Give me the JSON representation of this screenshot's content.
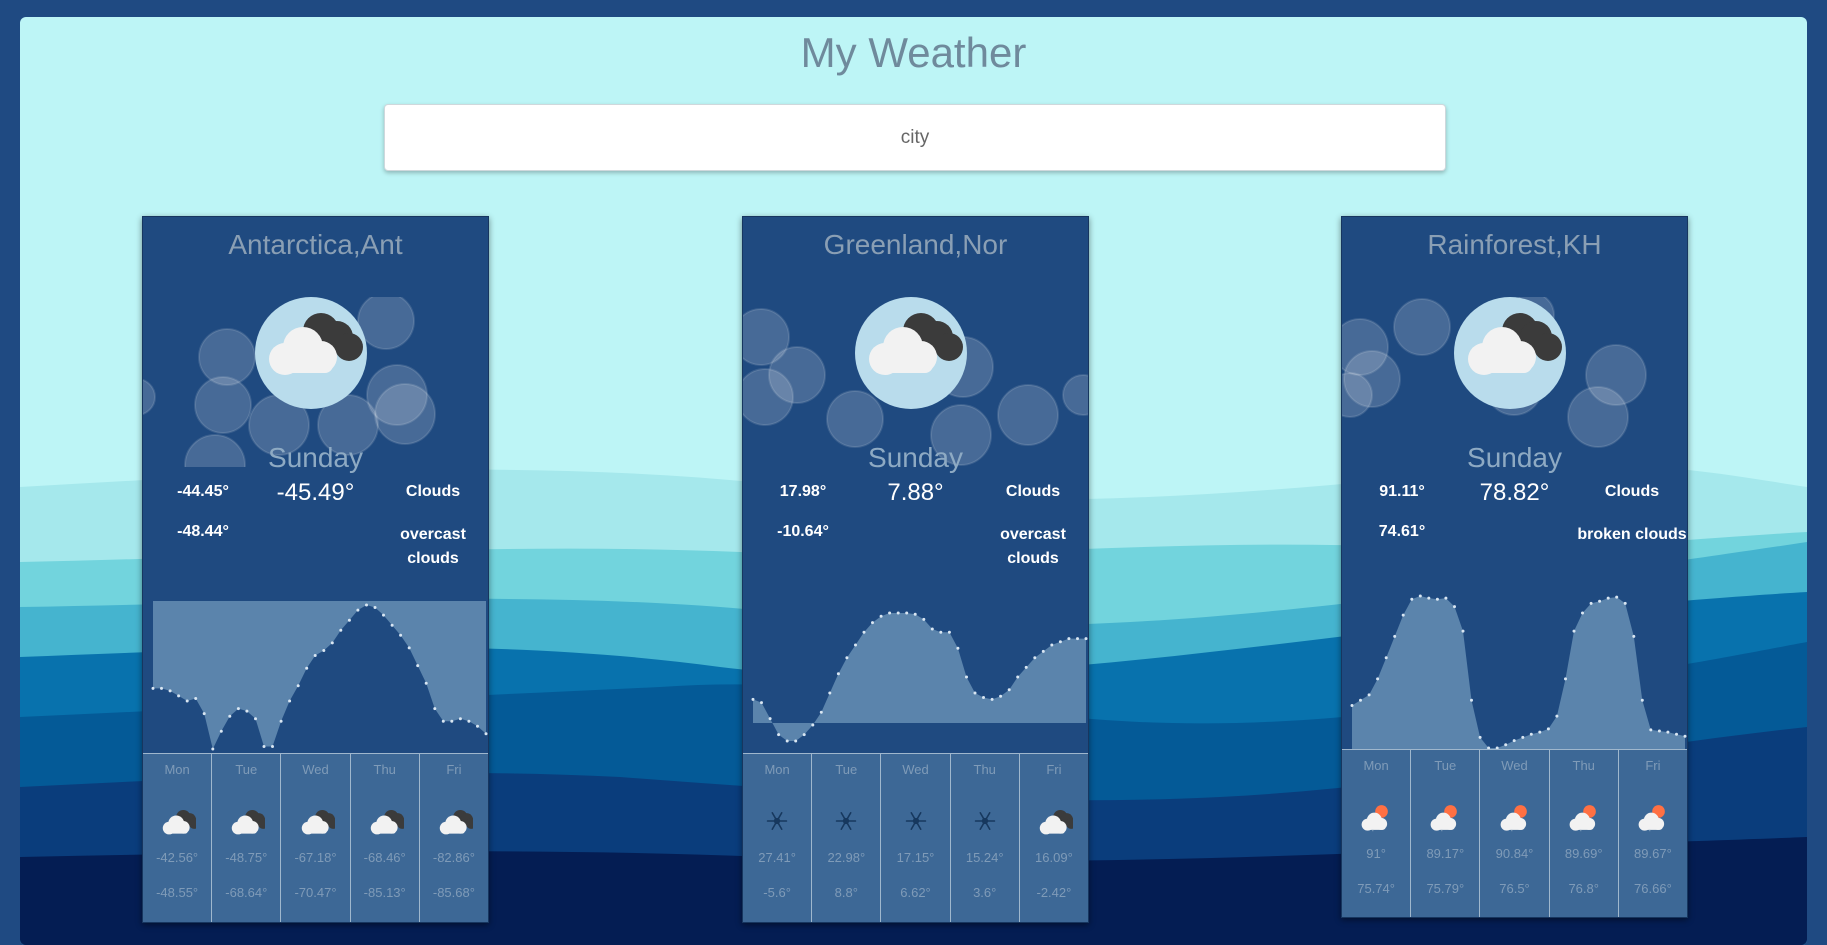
{
  "app": {
    "title": "My Weather"
  },
  "search": {
    "placeholder": "city"
  },
  "cards": [
    {
      "name": "Antarctica,Ant",
      "day": "Sunday",
      "icon": "cloudy-icon",
      "temp_high": "-44.45°",
      "temp_low": "-48.44°",
      "temp_current": "-45.49°",
      "condition": "Clouds",
      "description": "overcast clouds",
      "chart_style": "inverted",
      "trend": [
        -47.5,
        -47.5,
        -47.6,
        -47.8,
        -48.0,
        -47.9,
        -48.5,
        -49.9,
        -49.2,
        -48.6,
        -48.3,
        -48.4,
        -48.7,
        -49.8,
        -49.8,
        -48.8,
        -48.0,
        -47.4,
        -46.7,
        -46.2,
        -46.0,
        -45.7,
        -45.2,
        -44.8,
        -44.4,
        -44.2,
        -44.3,
        -44.6,
        -45.0,
        -45.4,
        -45.9,
        -46.6,
        -47.3,
        -48.3,
        -48.8,
        -48.8,
        -48.7,
        -48.8,
        -49.0,
        -49.3
      ],
      "forecast": [
        {
          "day": "Mon",
          "icon": "cloudy-icon",
          "high": "-42.56°",
          "low": "-48.55°"
        },
        {
          "day": "Tue",
          "icon": "cloudy-icon",
          "high": "-48.75°",
          "low": "-68.64°"
        },
        {
          "day": "Wed",
          "icon": "cloudy-icon",
          "high": "-67.18°",
          "low": "-70.47°"
        },
        {
          "day": "Thu",
          "icon": "cloudy-icon",
          "high": "-68.46°",
          "low": "-85.13°"
        },
        {
          "day": "Fri",
          "icon": "cloudy-icon",
          "high": "-82.86°",
          "low": "-85.68°"
        }
      ]
    },
    {
      "name": "Greenland,Nor",
      "day": "Sunday",
      "icon": "cloudy-icon",
      "temp_high": "17.98°",
      "temp_low": "-10.64°",
      "temp_current": "7.88°",
      "condition": "Clouds",
      "description": "overcast clouds",
      "chart_style": "baseline",
      "trend": [
        4.0,
        3.5,
        1.0,
        -1.5,
        -2.5,
        -2.5,
        -1.5,
        0,
        2,
        5,
        8,
        10.5,
        12.5,
        14.5,
        16,
        17,
        17.5,
        17.5,
        17.5,
        17.3,
        16.5,
        15,
        14.5,
        14.5,
        12,
        7.5,
        5,
        4.3,
        4.0,
        4.5,
        5.5,
        7.5,
        9,
        10.5,
        11.5,
        12.5,
        13.0,
        13.5,
        13.5,
        13.5
      ],
      "forecast": [
        {
          "day": "Mon",
          "icon": "snowflake-icon",
          "high": "27.41°",
          "low": "-5.6°"
        },
        {
          "day": "Tue",
          "icon": "snowflake-icon",
          "high": "22.98°",
          "low": "8.8°"
        },
        {
          "day": "Wed",
          "icon": "snowflake-icon",
          "high": "17.15°",
          "low": "6.62°"
        },
        {
          "day": "Thu",
          "icon": "snowflake-icon",
          "high": "15.24°",
          "low": "3.6°"
        },
        {
          "day": "Fri",
          "icon": "cloudy-icon",
          "high": "16.09°",
          "low": "-2.42°"
        }
      ]
    },
    {
      "name": "Rainforest,KH",
      "day": "Sunday",
      "icon": "cloudy-icon",
      "temp_high": "91.11°",
      "temp_low": "74.61°",
      "temp_current": "78.82°",
      "condition": "Clouds",
      "description": "broken clouds",
      "chart_style": "filled",
      "trend": [
        79.5,
        80,
        80.5,
        82,
        84,
        86,
        88,
        89.5,
        89.8,
        89.6,
        89.5,
        89.6,
        88.8,
        86.5,
        80,
        76.5,
        75.5,
        75.5,
        75.8,
        76.2,
        76.5,
        76.8,
        77,
        77.3,
        78.5,
        82,
        86.5,
        88.2,
        89.1,
        89.3,
        89.6,
        89.7,
        89.1,
        86,
        80,
        77.2,
        77.1,
        77,
        76.8,
        76.6
      ],
      "forecast": [
        {
          "day": "Mon",
          "icon": "sun-cloud-icon",
          "high": "91°",
          "low": "75.74°"
        },
        {
          "day": "Tue",
          "icon": "sun-cloud-icon",
          "high": "89.17°",
          "low": "75.79°"
        },
        {
          "day": "Wed",
          "icon": "sun-cloud-icon",
          "high": "90.84°",
          "low": "76.5°"
        },
        {
          "day": "Thu",
          "icon": "sun-cloud-icon",
          "high": "89.69°",
          "low": "76.8°"
        },
        {
          "day": "Fri",
          "icon": "sun-cloud-icon",
          "high": "89.67°",
          "low": "76.66°"
        }
      ]
    }
  ]
}
